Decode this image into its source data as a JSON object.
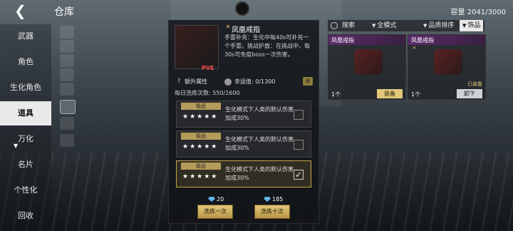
{
  "header": {
    "back_icon": "back-chevron-icon",
    "title": "仓库",
    "capacity": "容量 2041/3000"
  },
  "nav": {
    "items": [
      {
        "label": "武器"
      },
      {
        "label": "角色"
      },
      {
        "label": "生化角色"
      },
      {
        "label": "道具"
      },
      {
        "label": "万化"
      },
      {
        "label": "名片"
      },
      {
        "label": "个性化"
      },
      {
        "label": "回收"
      }
    ],
    "active_index": 3
  },
  "item": {
    "name": "凤凰戒指",
    "badge": "PVE",
    "desc": "手雷补充：生化中每40s可补充一个手雷。挑战护盾：在挑战中，每30s可免疫boss一次伤害。"
  },
  "attrs": {
    "q": "?",
    "extra_label": "额外属性",
    "luck_label": "幸运值: 0/1300"
  },
  "wash_count": "每日洗练次数: 550/1600",
  "options": [
    {
      "tag": "极品",
      "stars": "★★★★★",
      "text": "生化模式下人类的默认伤害加成30%",
      "checked": false
    },
    {
      "tag": "极品",
      "stars": "★★★★★",
      "text": "生化模式下人类的默认伤害加成30%",
      "checked": false
    },
    {
      "tag": "极品",
      "stars": "★★★★★",
      "text": "生化模式下人类的默认伤害加成30%",
      "checked": true
    }
  ],
  "check_glyph": "✓",
  "wash": {
    "once": {
      "cost": "20",
      "label": "洗练一次"
    },
    "ten": {
      "cost": "185",
      "label": "洗练十次"
    }
  },
  "filters": {
    "search": "搜索",
    "mode": "全模式",
    "quality": "品质排序",
    "category": "饰品"
  },
  "cards": [
    {
      "name": "凤凰戒指",
      "qty": "1个",
      "button": "装备",
      "equipped": ""
    },
    {
      "name": "凤凰戒指",
      "qty": "1个",
      "button": "卸下",
      "equipped": "已装备"
    }
  ],
  "colors": {
    "accent_gold": "#e2c77a",
    "panel_bg": "#121418",
    "active_nav_bg": "#e9e9e9",
    "pve_red": "#ff4b4b"
  }
}
